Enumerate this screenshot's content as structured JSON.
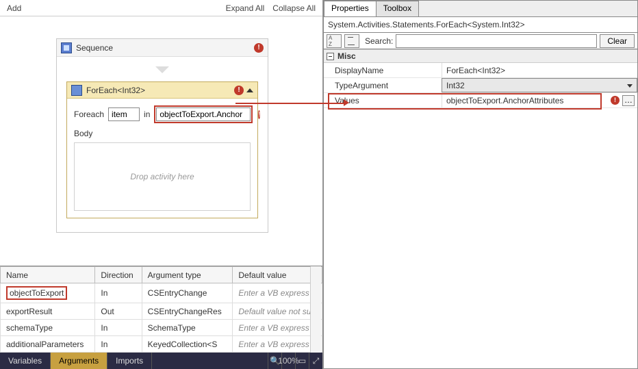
{
  "designer": {
    "add": "Add",
    "expand_all": "Expand All",
    "collapse_all": "Collapse All",
    "sequence_title": "Sequence",
    "foreach_title": "ForEach<Int32>",
    "foreach_label": "Foreach",
    "item_value": "item",
    "in_label": "in",
    "values_expr": "objectToExport.Anchor",
    "body_label": "Body",
    "drop_hint": "Drop activity here"
  },
  "arguments": {
    "headers": {
      "name": "Name",
      "direction": "Direction",
      "argtype": "Argument type",
      "default": "Default value"
    },
    "rows": [
      {
        "name": "objectToExport",
        "direction": "In",
        "argtype": "CSEntryChange",
        "default": "Enter a VB express",
        "highlight": true
      },
      {
        "name": "exportResult",
        "direction": "Out",
        "argtype": "CSEntryChangeRes",
        "default": "Default value not su",
        "highlight": false
      },
      {
        "name": "schemaType",
        "direction": "In",
        "argtype": "SchemaType",
        "default": "Enter a VB express",
        "highlight": false
      },
      {
        "name": "additionalParameters",
        "direction": "In",
        "argtype": "KeyedCollection<S",
        "default": "Enter a VB express",
        "highlight": false
      }
    ]
  },
  "bottom_tabs": {
    "variables": "Variables",
    "arguments": "Arguments",
    "imports": "Imports",
    "zoom": "100%"
  },
  "properties": {
    "tab_properties": "Properties",
    "tab_toolbox": "Toolbox",
    "type_line": "System.Activities.Statements.ForEach<System.Int32>",
    "search_label": "Search:",
    "clear_label": "Clear",
    "category": "Misc",
    "rows": {
      "display_name": {
        "label": "DisplayName",
        "value": "ForEach<Int32>"
      },
      "type_argument": {
        "label": "TypeArgument",
        "value": "Int32"
      },
      "values": {
        "label": "Values",
        "value": "objectToExport.AnchorAttributes"
      }
    }
  }
}
